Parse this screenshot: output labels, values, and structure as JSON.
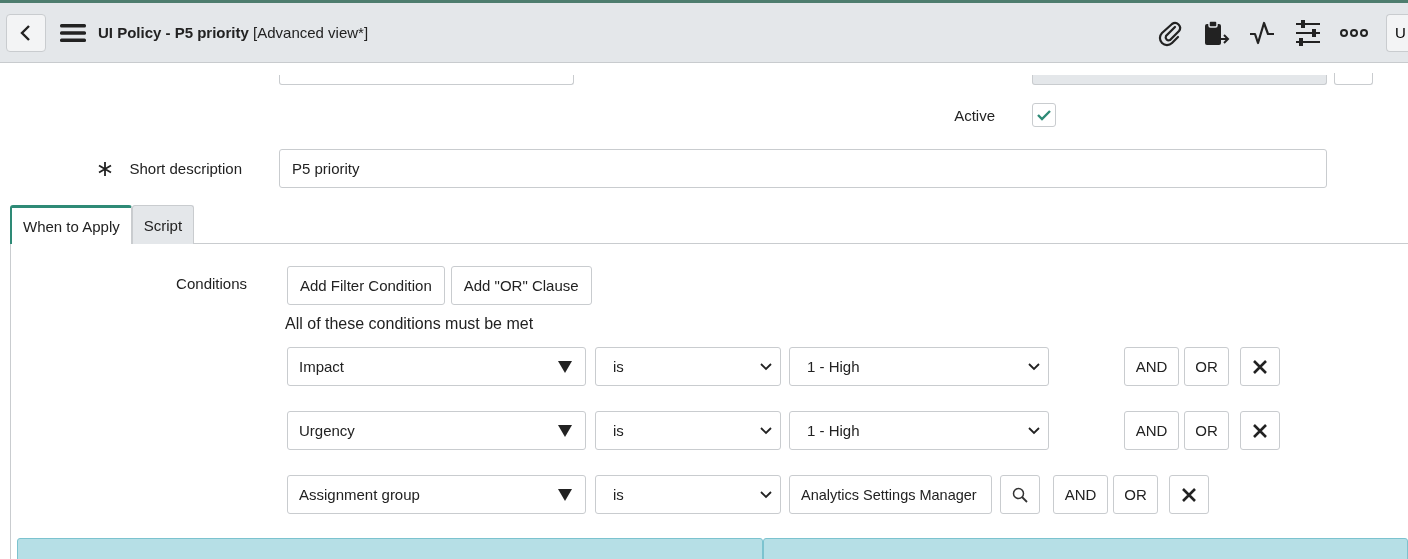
{
  "header": {
    "title": "UI Policy - P5 priority",
    "view": "[Advanced view*]",
    "edge_button": "U"
  },
  "form": {
    "active": {
      "label": "Active",
      "checked": true
    },
    "short_description": {
      "label": "Short description",
      "required": true,
      "value": "P5 priority"
    }
  },
  "tabs": [
    {
      "label": "When to Apply",
      "selected": true
    },
    {
      "label": "Script",
      "selected": false
    }
  ],
  "conditions": {
    "label": "Conditions",
    "buttons": [
      "Add Filter Condition",
      "Add \"OR\" Clause"
    ],
    "note": "All of these conditions must be met",
    "rows": [
      {
        "kind": "choice",
        "field": "Impact",
        "operator": "is",
        "value": "1 - High",
        "and": "AND",
        "or": "OR"
      },
      {
        "kind": "choice",
        "field": "Urgency",
        "operator": "is",
        "value": "1 - High",
        "and": "AND",
        "or": "OR"
      },
      {
        "kind": "reference",
        "field": "Assignment group",
        "operator": "is",
        "value": "Analytics Settings Manager",
        "and": "AND",
        "or": "OR"
      }
    ]
  }
}
